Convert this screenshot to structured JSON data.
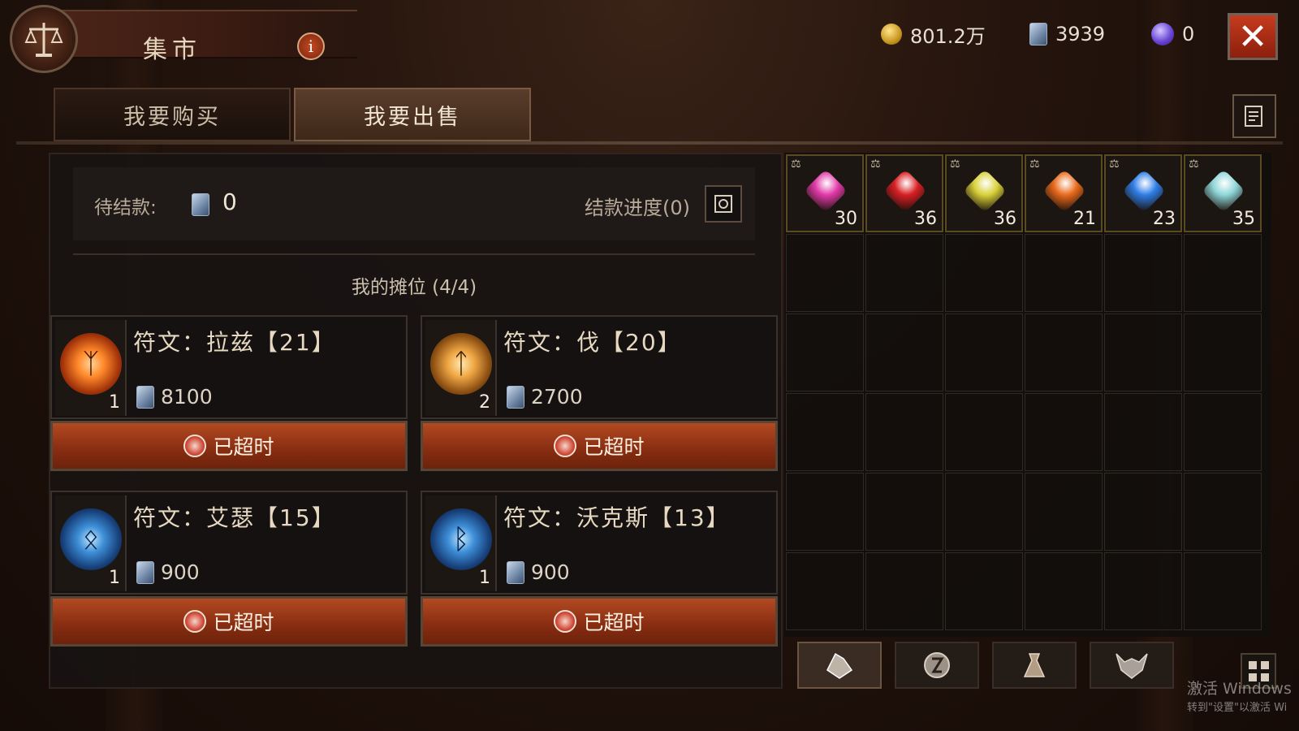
{
  "header": {
    "title": "集市",
    "info_icon": "i",
    "close_icon": "✕"
  },
  "currencies": {
    "gold": "801.2万",
    "silver": "3939",
    "purple": "0"
  },
  "tabs": [
    {
      "label": "我要购买",
      "active": false
    },
    {
      "label": "我要出售",
      "active": true
    }
  ],
  "pending": {
    "label": "待结款:",
    "value": "0",
    "progress_label": "结款进度(0)"
  },
  "stall": {
    "title": "我的摊位 (4/4)",
    "listings": [
      {
        "name": "符文：拉兹【21】",
        "count": "1",
        "price": "8100",
        "status": "已超时",
        "rune_color": "orange"
      },
      {
        "name": "符文：伐【20】",
        "count": "2",
        "price": "2700",
        "status": "已超时",
        "rune_color": "gold"
      },
      {
        "name": "符文：艾瑟【15】",
        "count": "1",
        "price": "900",
        "status": "已超时",
        "rune_color": "blue"
      },
      {
        "name": "符文：沃克斯【13】",
        "count": "1",
        "price": "900",
        "status": "已超时",
        "rune_color": "blue"
      }
    ]
  },
  "inventory": {
    "gems": [
      {
        "color": "#e23aa8",
        "count": "30"
      },
      {
        "color": "#d81f23",
        "count": "36"
      },
      {
        "color": "#d9d23a",
        "count": "36"
      },
      {
        "color": "#e86a1c",
        "count": "21"
      },
      {
        "color": "#2f7ee6",
        "count": "23"
      },
      {
        "color": "#8fd6d8",
        "count": "35"
      }
    ],
    "tabs": [
      "gem-tab-icon",
      "rune-tab-icon",
      "bag-tab-icon",
      "demon-tab-icon"
    ]
  },
  "watermark": {
    "line1": "激活 Windows",
    "line2": "转到\"设置\"以激活 Wi"
  }
}
